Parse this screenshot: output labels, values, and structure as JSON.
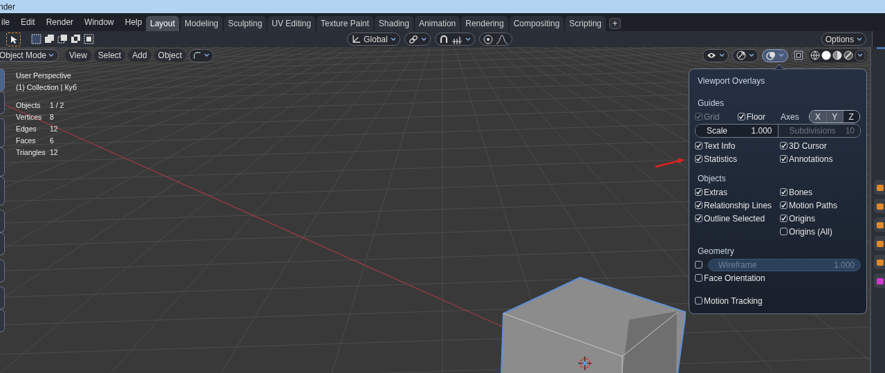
{
  "title_bar": {
    "title": "nder"
  },
  "menu": [
    "ile",
    "Edit",
    "Render",
    "Window",
    "Help"
  ],
  "workspace_tabs": [
    {
      "label": "Layout",
      "selected": true
    },
    {
      "label": "Modeling",
      "selected": false
    },
    {
      "label": "Sculpting",
      "selected": false
    },
    {
      "label": "UV Editing",
      "selected": false
    },
    {
      "label": "Texture Paint",
      "selected": false
    },
    {
      "label": "Shading",
      "selected": false
    },
    {
      "label": "Animation",
      "selected": false
    },
    {
      "label": "Rendering",
      "selected": false
    },
    {
      "label": "Compositing",
      "selected": false
    },
    {
      "label": "Scripting",
      "selected": false
    }
  ],
  "add_tab": "+",
  "tool_header": {
    "orientation": "Global",
    "options": "Options"
  },
  "viewport_header": {
    "mode": "Object Mode",
    "menus": [
      "View",
      "Select",
      "Add",
      "Object"
    ],
    "overlays_expanded": true
  },
  "viewport_info": {
    "view": "User Perspective",
    "collection": "(1) Collection | Куб",
    "stats": [
      {
        "label": "Objects",
        "value": "1 / 2"
      },
      {
        "label": "Vertices",
        "value": "8"
      },
      {
        "label": "Edges",
        "value": "12"
      },
      {
        "label": "Faces",
        "value": "6"
      },
      {
        "label": "Triangles",
        "value": "12"
      }
    ]
  },
  "overlays": {
    "title": "Viewport Overlays",
    "guides": {
      "heading": "Guides",
      "grid": {
        "label": "Grid",
        "checked": true,
        "disabled": true
      },
      "floor": {
        "label": "Floor",
        "checked": true
      },
      "axes_label": "Axes",
      "axes": [
        {
          "label": "X",
          "on": true
        },
        {
          "label": "Y",
          "on": true
        },
        {
          "label": "Z",
          "on": false
        }
      ],
      "scale": {
        "label": "Scale",
        "value": "1.000"
      },
      "subdivisions": {
        "label": "Subdivisions",
        "value": "10",
        "disabled": true
      },
      "checks_left": [
        {
          "label": "Text Info",
          "checked": true
        },
        {
          "label": "Statistics",
          "checked": true
        }
      ],
      "checks_right": [
        {
          "label": "3D Cursor",
          "checked": true
        },
        {
          "label": "Annotations",
          "checked": true
        }
      ]
    },
    "objects": {
      "heading": "Objects",
      "checks_left": [
        {
          "label": "Extras",
          "checked": true
        },
        {
          "label": "Relationship Lines",
          "checked": true
        },
        {
          "label": "Outline Selected",
          "checked": true
        }
      ],
      "checks_right": [
        {
          "label": "Bones",
          "checked": true
        },
        {
          "label": "Motion Paths",
          "checked": true
        },
        {
          "label": "Origins",
          "checked": true
        },
        {
          "label": "Origins (All)",
          "checked": false
        }
      ]
    },
    "geometry": {
      "heading": "Geometry",
      "wireframe": {
        "checked": false,
        "label": "Wireframe",
        "value": "1.000",
        "level": 1
      },
      "checks": [
        {
          "label": "Face Orientation",
          "checked": false
        }
      ]
    },
    "motion_tracking": {
      "label": "Motion Tracking",
      "checked": false
    }
  }
}
